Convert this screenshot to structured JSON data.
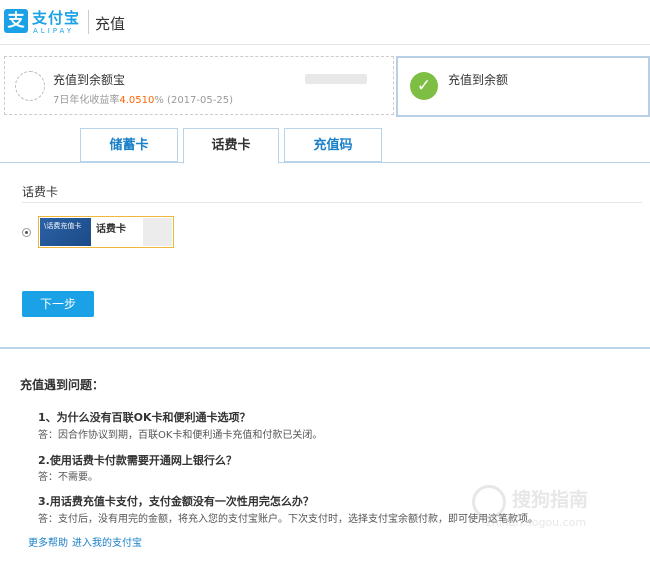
{
  "header": {
    "logo_cn": "支付宝",
    "logo_en": "ALIPAY",
    "title": "充值"
  },
  "options": {
    "yuebao": {
      "title": "充值到余额宝",
      "sub_prefix": "7日年化收益率",
      "rate": "4.0510",
      "sub_suffix": "% (2017-05-25)"
    },
    "balance": {
      "title": "充值到余额",
      "check_glyph": "✓"
    }
  },
  "tabs": [
    {
      "label": "储蓄卡",
      "active": false
    },
    {
      "label": "话费卡",
      "active": true
    },
    {
      "label": "充值码",
      "active": false
    }
  ],
  "panel": {
    "label": "话费卡",
    "card": {
      "image_text": "\\话费充值卡",
      "name": "话费卡"
    },
    "next_button": "下一步"
  },
  "help": {
    "title": "充值遇到问题：",
    "items": [
      {
        "q": "1、为什么没有百联OK卡和便利通卡选项？",
        "a": "答：因合作协议到期，百联OK卡和便利通卡充值和付款已关闭。"
      },
      {
        "q": "2.使用话费卡付款需要开通网上银行么？",
        "a": "答：不需要。"
      },
      {
        "q": "3.用话费充值卡支付，支付金额没有一次性用完怎么办？",
        "a": "答：支付后，没有用完的金额，将充入您的支付宝账户。下次支付时，选择支付宝余额付款，即可使用这笔款项。"
      }
    ],
    "more_help": "更多帮助",
    "my_alipay": "进入我的支付宝"
  },
  "watermark": {
    "cn": "搜狗指南",
    "en": "zhinan.sogou.com"
  },
  "colors": {
    "brand": "#1aa1e6",
    "rate": "#ff6600",
    "check": "#7fbe44",
    "tab_border": "#b8d4ea"
  }
}
